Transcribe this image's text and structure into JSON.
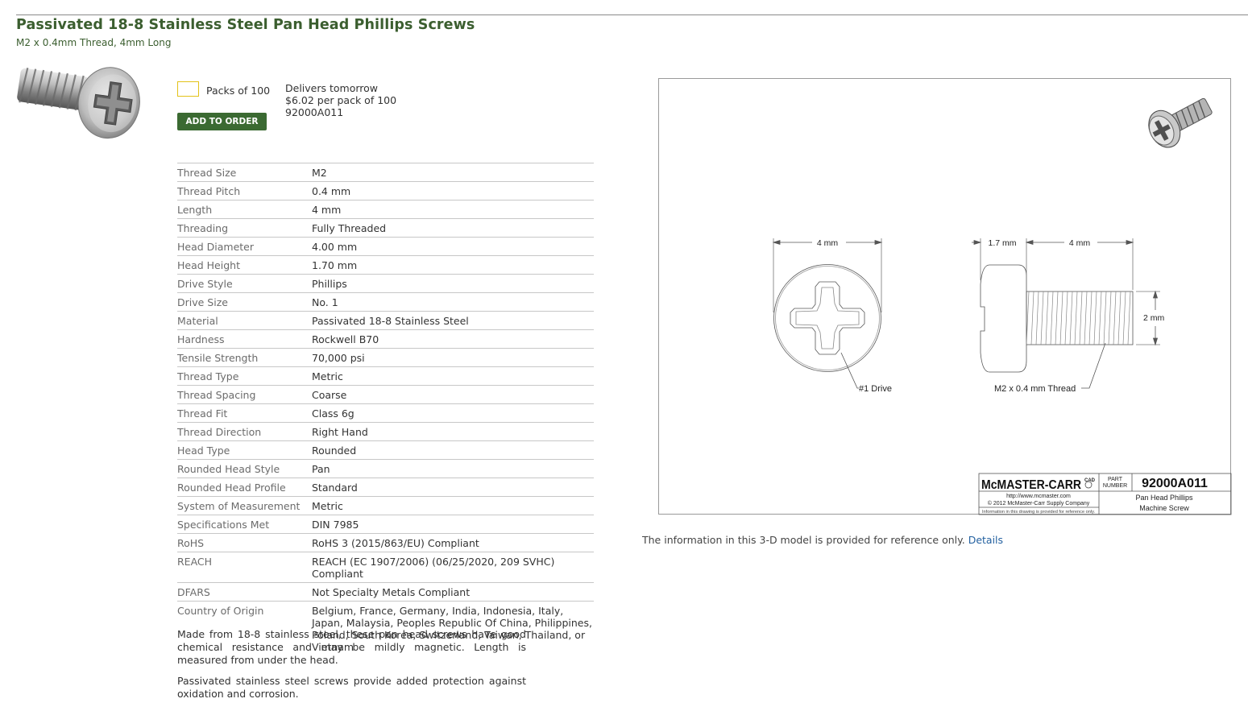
{
  "product": {
    "title": "Passivated 18-8 Stainless Steel Pan Head Phillips Screws",
    "subtitle": "M2 x 0.4mm Thread, 4mm Long"
  },
  "order": {
    "quantity_value": "",
    "pack_label": "Packs of 100",
    "add_button": "ADD TO ORDER",
    "delivery": "Delivers tomorrow",
    "price": "$6.02 per pack of 100",
    "part_number": "92000A011"
  },
  "specs": [
    {
      "key": "Thread Size",
      "value": "M2"
    },
    {
      "key": "Thread Pitch",
      "value": "0.4 mm"
    },
    {
      "key": "Length",
      "value": "4 mm"
    },
    {
      "key": "Threading",
      "value": "Fully Threaded"
    },
    {
      "key": "Head Diameter",
      "value": "4.00 mm"
    },
    {
      "key": "Head Height",
      "value": "1.70 mm"
    },
    {
      "key": "Drive Style",
      "value": "Phillips"
    },
    {
      "key": "Drive Size",
      "value": "No. 1"
    },
    {
      "key": "Material",
      "value": "Passivated 18-8 Stainless Steel"
    },
    {
      "key": "Hardness",
      "value": "Rockwell B70"
    },
    {
      "key": "Tensile Strength",
      "value": "70,000 psi"
    },
    {
      "key": "Thread Type",
      "value": "Metric"
    },
    {
      "key": "Thread Spacing",
      "value": "Coarse"
    },
    {
      "key": "Thread Fit",
      "value": "Class 6g"
    },
    {
      "key": "Thread Direction",
      "value": "Right Hand"
    },
    {
      "key": "Head Type",
      "value": "Rounded"
    },
    {
      "key": "Rounded Head Style",
      "value": "Pan"
    },
    {
      "key": "Rounded Head Profile",
      "value": "Standard"
    },
    {
      "key": "System of Measurement",
      "value": "Metric"
    },
    {
      "key": "Specifications Met",
      "value": "DIN 7985"
    },
    {
      "key": "RoHS",
      "value": "RoHS 3 (2015/863/EU) Compliant"
    },
    {
      "key": "REACH",
      "value": "REACH (EC 1907/2006) (06/25/2020, 209 SVHC) Compliant"
    },
    {
      "key": "DFARS",
      "value": "Not Specialty Metals Compliant"
    },
    {
      "key": "Country of Origin",
      "value": "Belgium, France, Germany, India, Indonesia, Italy, Japan, Malaysia, Peoples Republic Of China, Philippines, Poland, South Korea, Switzerland, Taiwan, Thailand, or Vietnam"
    }
  ],
  "description": [
    "Made from 18-8 stainless steel, these pan head screws have good chemical resistance and may be mildly magnetic. Length is measured from under the head.",
    "Passivated stainless steel screws provide added protection against oxidation and corrosion."
  ],
  "drawing": {
    "dim_head_diameter": "4 mm",
    "dim_head_height": "1.7 mm",
    "dim_length": "4 mm",
    "dim_thread_dia": "2 mm",
    "drive_label": "#1 Drive",
    "thread_label": "M2 x 0.4 mm Thread",
    "brand": "McMASTER-CARR",
    "cad_mark": "CAD",
    "part_label_1": "PART",
    "part_label_2": "NUMBER",
    "part_number": "92000A011",
    "website": "http://www.mcmaster.com",
    "copyright": "© 2012 McMaster-Carr Supply Company",
    "disclaimer": "Information in this drawing is provided for reference only.",
    "desc_line1": "Pan Head Phillips",
    "desc_line2": "Machine Screw"
  },
  "reference_note": {
    "text": "The information in this 3-D model is provided for reference only.",
    "link": "Details"
  }
}
